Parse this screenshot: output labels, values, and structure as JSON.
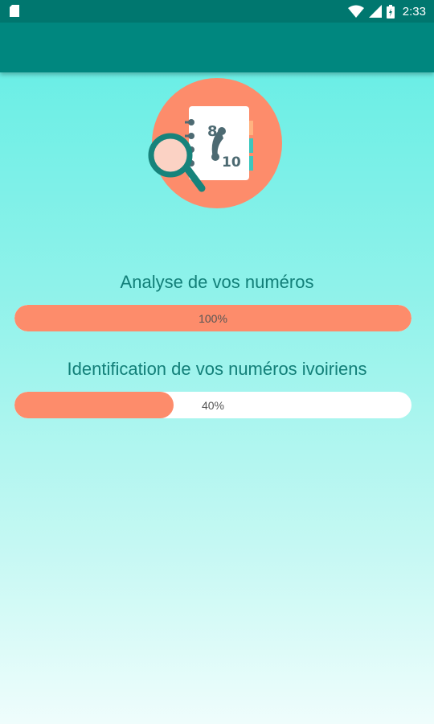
{
  "status_bar": {
    "time": "2:33",
    "icons": [
      "sd-card-icon",
      "wifi-icon",
      "signal-icon",
      "battery-icon"
    ]
  },
  "app_bar": {
    "title": ""
  },
  "illustration": {
    "icon": "phonebook-search-icon",
    "numbers": [
      "8",
      "10"
    ]
  },
  "progress": [
    {
      "label": "Analyse de vos numéros",
      "value": 100,
      "text": "100%"
    },
    {
      "label": "Identification de vos numéros ivoiriens",
      "value": 40,
      "text": "40%"
    }
  ],
  "colors": {
    "status_bar": "#00776f",
    "app_bar": "#00877f",
    "accent": "#fd8c6b",
    "label_text": "#127f78",
    "track": "#ffffff"
  }
}
